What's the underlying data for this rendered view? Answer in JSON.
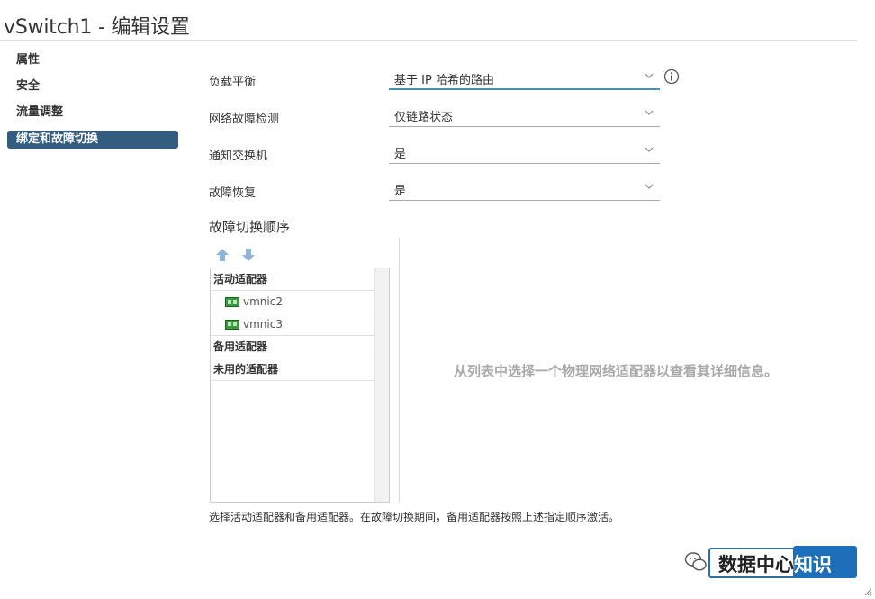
{
  "window": {
    "title": "vSwitch1 - 编辑设置"
  },
  "sidebar": {
    "items": [
      {
        "label": "属性",
        "active": false
      },
      {
        "label": "安全",
        "active": false
      },
      {
        "label": "流量调整",
        "active": false
      },
      {
        "label": "绑定和故障切换",
        "active": true
      }
    ]
  },
  "form": {
    "load_balancing": {
      "label": "负载平衡",
      "value": "基于 IP 哈希的路由"
    },
    "failure_detection": {
      "label": "网络故障检测",
      "value": "仅链路状态"
    },
    "notify_switches": {
      "label": "通知交换机",
      "value": "是"
    },
    "failback": {
      "label": "故障恢复",
      "value": "是"
    }
  },
  "failover_order": {
    "title": "故障切换顺序",
    "active_group": "活动适配器",
    "active_adapters": [
      "vmnic2",
      "vmnic3"
    ],
    "standby_group": "备用适配器",
    "unused_group": "未用的适配器",
    "detail_message": "从列表中选择一个物理网络适配器以查看其详细信息。",
    "footnote": "选择活动适配器和备用适配器。在故障切换期间，备用适配器按照上述指定顺序激活。"
  },
  "watermark": {
    "part1": "数据中心",
    "part2": "知识"
  },
  "icons": {
    "move_up": "arrow-up-icon",
    "move_down": "arrow-down-icon",
    "info": "info-icon",
    "nic": "network-card-icon",
    "chevron": "chevron-down-icon"
  },
  "colors": {
    "active_nav": "#325c80",
    "focus_underline": "#4a90a4",
    "arrow": "#8fb4d9",
    "nic_green": "#3c9a3c",
    "watermark_blue": "#1c6fb8"
  }
}
